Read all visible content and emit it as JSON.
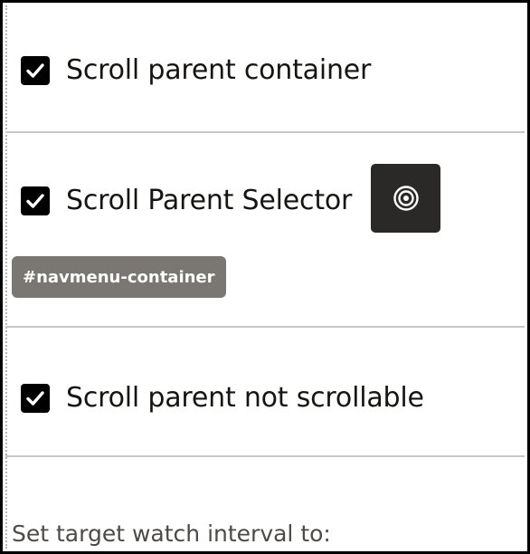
{
  "options": [
    {
      "label": "Scroll parent container",
      "checked": true
    },
    {
      "label": "Scroll Parent Selector",
      "checked": true
    },
    {
      "label": "Scroll parent not scrollable",
      "checked": true
    }
  ],
  "selector_chip": {
    "value": "#navmenu-container"
  },
  "target_button": {
    "icon": "target-icon"
  },
  "interval": {
    "label": "Set target watch interval to:"
  },
  "colors": {
    "checkbox": "#000000",
    "target_button": "#2b2927",
    "chip_bg": "#7a7672",
    "divider": "#c9c7c3"
  }
}
